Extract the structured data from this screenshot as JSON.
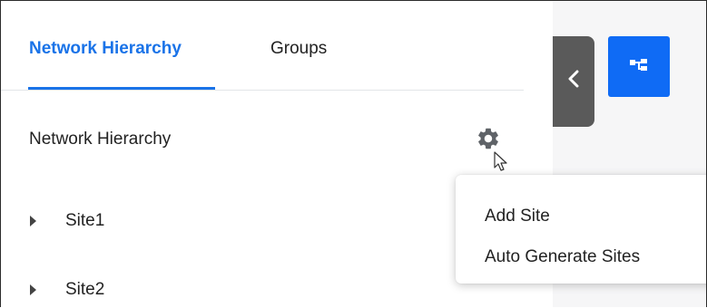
{
  "tabs": [
    {
      "label": "Network Hierarchy",
      "active": true
    },
    {
      "label": "Groups",
      "active": false
    }
  ],
  "section_title": "Network Hierarchy",
  "tree": [
    {
      "label": "Site1"
    },
    {
      "label": "Site2"
    }
  ],
  "context_menu": {
    "items": [
      {
        "label": "Add Site"
      },
      {
        "label": "Auto Generate Sites"
      }
    ]
  },
  "icons": {
    "settings": "gear-icon",
    "collapse": "chevron-left-icon",
    "hierarchy": "hierarchy-tree-icon",
    "expand": "caret-right-icon",
    "pointer": "mouse-cursor-icon"
  },
  "colors": {
    "accent": "#1a73e8",
    "primary_button": "#0f6bf5",
    "collapse_button": "#5a5a5a",
    "right_panel_bg": "#f6f6f7"
  }
}
